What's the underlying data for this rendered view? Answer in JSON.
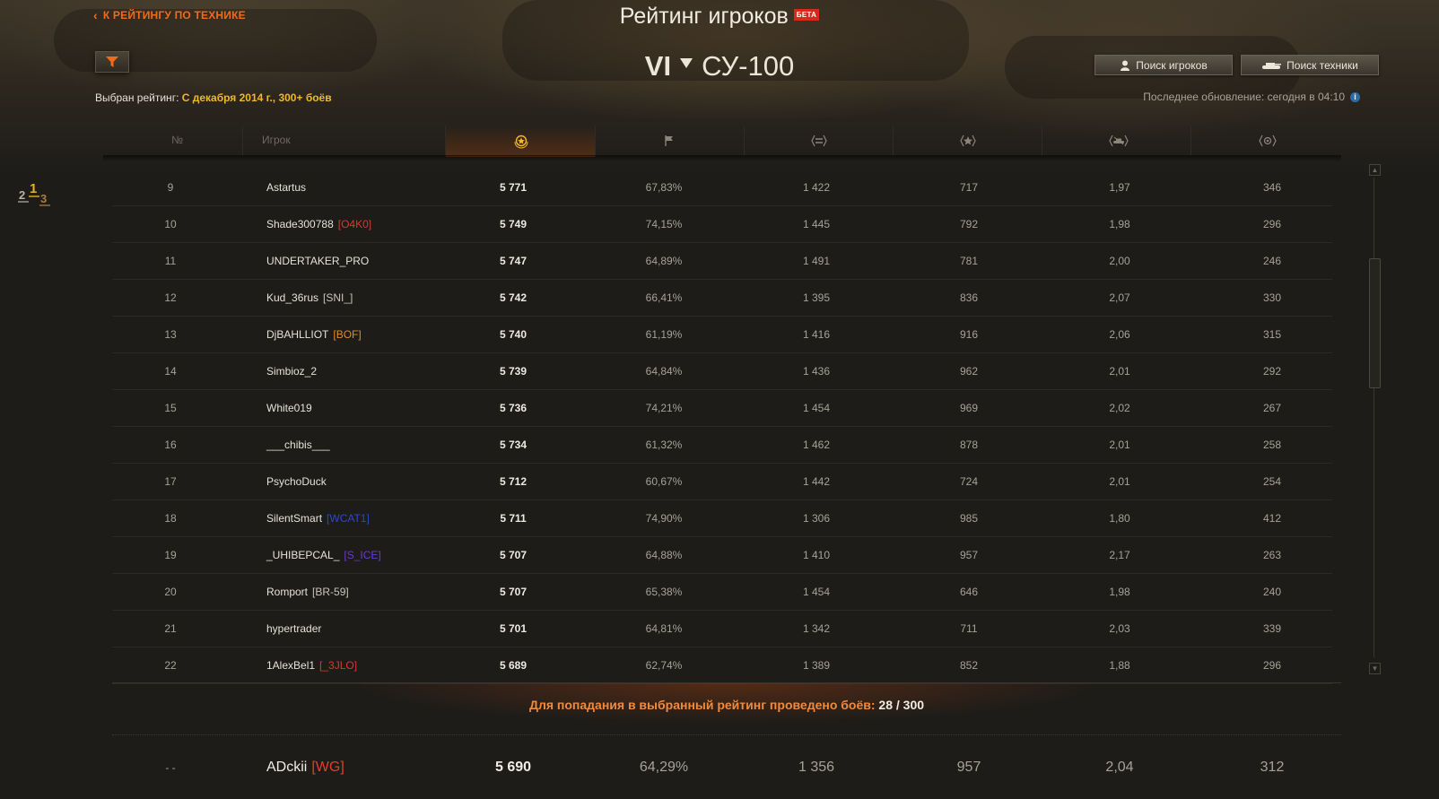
{
  "header": {
    "back_link": "К РЕЙТИНГУ ПО ТЕХНИКЕ",
    "title": "Рейтинг игроков",
    "beta_badge": "БЕТА",
    "vehicle_tier": "VI",
    "vehicle_name": "СУ-100",
    "selected_label": "Выбран рейтинг: ",
    "selected_value": "С декабря 2014 г., 300+ боёв",
    "search_players": "Поиск игроков",
    "search_vehicles": "Поиск техники",
    "update_info": "Последнее обновление: сегодня в 04:10"
  },
  "colors": {
    "accent": "#f26a1a",
    "highlight": "#f2b82a"
  },
  "columns": [
    {
      "label": "№",
      "icon": null
    },
    {
      "label": "Игрок",
      "icon": null
    },
    {
      "label": "",
      "icon": "rating-emblem-icon"
    },
    {
      "label": "",
      "icon": "flag-icon"
    },
    {
      "label": "",
      "icon": "damage-icon"
    },
    {
      "label": "",
      "icon": "star-icon"
    },
    {
      "label": "",
      "icon": "tank-kills-icon"
    },
    {
      "label": "",
      "icon": "spotting-icon"
    }
  ],
  "rows": [
    {
      "rank": "9",
      "player": "Astartus",
      "clan": "",
      "clan_color": "#a6a297",
      "rating": "5 771",
      "win": "67,83%",
      "dmg": "1 422",
      "exp": "717",
      "kills": "1,97",
      "spot": "346"
    },
    {
      "rank": "10",
      "player": "Shade300788",
      "clan": "[O4K0]",
      "clan_color": "#d83a2b",
      "rating": "5 749",
      "win": "74,15%",
      "dmg": "1 445",
      "exp": "792",
      "kills": "1,98",
      "spot": "296"
    },
    {
      "rank": "11",
      "player": "UNDERTAKER_PRO",
      "clan": "",
      "clan_color": "#a6a297",
      "rating": "5 747",
      "win": "64,89%",
      "dmg": "1 491",
      "exp": "781",
      "kills": "2,00",
      "spot": "246"
    },
    {
      "rank": "12",
      "player": "Kud_36rus",
      "clan": "[SNI_]",
      "clan_color": "#c9c5bb",
      "rating": "5 742",
      "win": "66,41%",
      "dmg": "1 395",
      "exp": "836",
      "kills": "2,07",
      "spot": "330"
    },
    {
      "rank": "13",
      "player": "DjBAHLLIOT",
      "clan": "[BOF]",
      "clan_color": "#e08a2a",
      "rating": "5 740",
      "win": "61,19%",
      "dmg": "1 416",
      "exp": "916",
      "kills": "2,06",
      "spot": "315"
    },
    {
      "rank": "14",
      "player": "Simbioz_2",
      "clan": "",
      "clan_color": "#a6a297",
      "rating": "5 739",
      "win": "64,84%",
      "dmg": "1 436",
      "exp": "962",
      "kills": "2,01",
      "spot": "292"
    },
    {
      "rank": "15",
      "player": "White019",
      "clan": "",
      "clan_color": "#a6a297",
      "rating": "5 736",
      "win": "74,21%",
      "dmg": "1 454",
      "exp": "969",
      "kills": "2,02",
      "spot": "267"
    },
    {
      "rank": "16",
      "player": "___chibis___",
      "clan": "",
      "clan_color": "#a6a297",
      "rating": "5 734",
      "win": "61,32%",
      "dmg": "1 462",
      "exp": "878",
      "kills": "2,01",
      "spot": "258"
    },
    {
      "rank": "17",
      "player": "PsychoDuck",
      "clan": "",
      "clan_color": "#a6a297",
      "rating": "5 712",
      "win": "60,67%",
      "dmg": "1 442",
      "exp": "724",
      "kills": "2,01",
      "spot": "254"
    },
    {
      "rank": "18",
      "player": "SilentSmart",
      "clan": "[WCAT1]",
      "clan_color": "#2f48c8",
      "rating": "5 711",
      "win": "74,90%",
      "dmg": "1 306",
      "exp": "985",
      "kills": "1,80",
      "spot": "412"
    },
    {
      "rank": "19",
      "player": "_UHIBEPCAL_",
      "clan": "[S_ICE]",
      "clan_color": "#6a3cc8",
      "rating": "5 707",
      "win": "64,88%",
      "dmg": "1 410",
      "exp": "957",
      "kills": "2,17",
      "spot": "263"
    },
    {
      "rank": "20",
      "player": "Romport",
      "clan": "[BR-59]",
      "clan_color": "#c9c5bb",
      "rating": "5 707",
      "win": "65,38%",
      "dmg": "1 454",
      "exp": "646",
      "kills": "1,98",
      "spot": "240"
    },
    {
      "rank": "21",
      "player": "hypertrader",
      "clan": "",
      "clan_color": "#a6a297",
      "rating": "5 701",
      "win": "64,81%",
      "dmg": "1 342",
      "exp": "711",
      "kills": "2,03",
      "spot": "339"
    },
    {
      "rank": "22",
      "player": "1AlexBel1",
      "clan": "[_3JLO]",
      "clan_color": "#d83a2b",
      "rating": "5 689",
      "win": "62,74%",
      "dmg": "1 389",
      "exp": "852",
      "kills": "1,88",
      "spot": "296"
    }
  ],
  "notice": {
    "text": "Для попадания в выбранный рейтинг проведено боёв: ",
    "count": "28 / 300"
  },
  "my_row": {
    "rank": "- -",
    "player": "ADckii",
    "clan": "[WG]",
    "rating": "5 690",
    "win": "64,29%",
    "dmg": "1 356",
    "exp": "957",
    "kills": "2,04",
    "spot": "312"
  }
}
